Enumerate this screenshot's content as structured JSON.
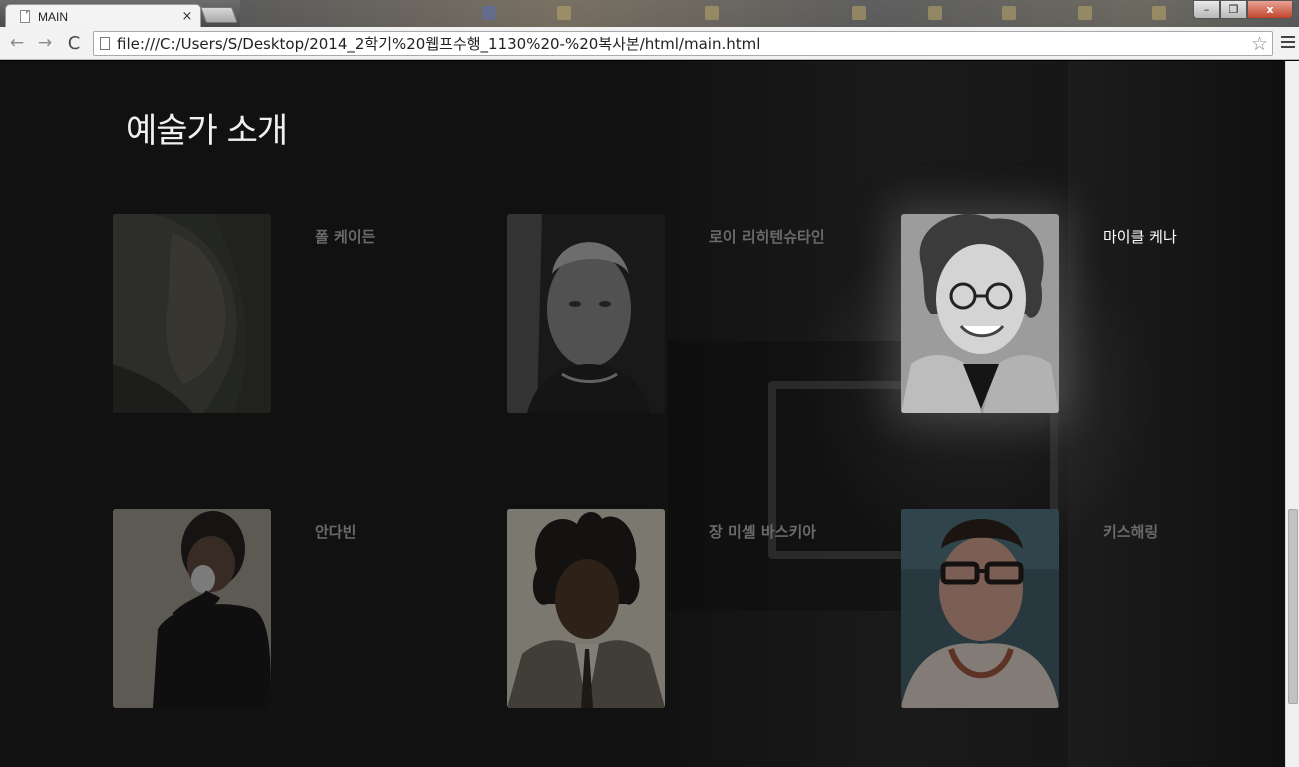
{
  "browser": {
    "tab_title": "MAIN",
    "tab_close": "×",
    "url": "file:///C:/Users/S/Desktop/2014_2학기%20웹프수행_1130%20-%20복사본/html/main.html",
    "back": "←",
    "forward": "→",
    "reload": "C",
    "star": "☆",
    "win_min": "–",
    "win_max": "❐",
    "win_close": "x"
  },
  "page": {
    "title": "예술가 소개",
    "active_artist": "마이클 케나",
    "artists": [
      {
        "name": "폴 케이든",
        "photo": "portrait-paul-cadden"
      },
      {
        "name": "로이 리히텐슈타인",
        "photo": "portrait-roy-lichtenstein"
      },
      {
        "name": "마이클 케나",
        "photo": "portrait-michael-kenna"
      },
      {
        "name": "안다빈",
        "photo": "portrait-an-dabin"
      },
      {
        "name": "장 미셸 바스키아",
        "photo": "portrait-jean-michel-basquiat"
      },
      {
        "name": "키스해링",
        "photo": "portrait-keith-haring"
      }
    ]
  }
}
